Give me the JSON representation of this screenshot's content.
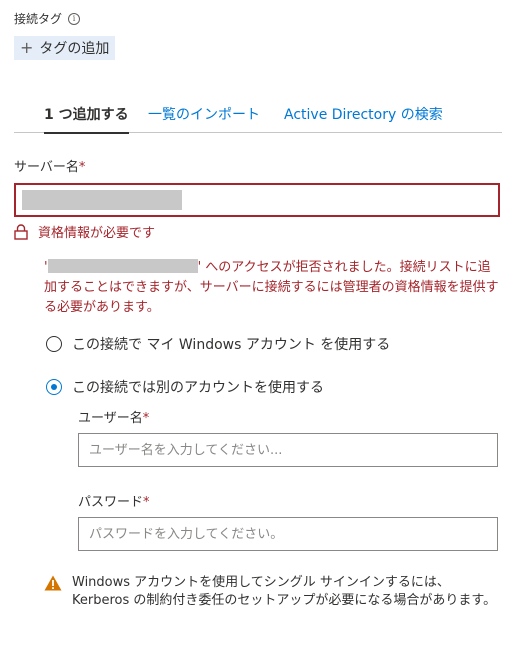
{
  "tags": {
    "label": "接続タグ",
    "info_icon": "info-icon",
    "add_button": "タグの追加",
    "add_icon": "plus-icon"
  },
  "tabs": [
    {
      "label": "1 つ追加する",
      "active": true
    },
    {
      "label": "一覧のインポート",
      "active": false
    },
    {
      "label": "Active Directory の検索",
      "active": false
    }
  ],
  "server": {
    "label": "サーバー名",
    "required_mark": "*",
    "value_redacted": true
  },
  "credential_error": {
    "icon": "lock-icon",
    "text": "資格情報が必要です",
    "message_prefix": "'",
    "message_suffix": "' へのアクセスが拒否されました。接続リストに追加することはできますが、サーバーに接続するには管理者の資格情報を提供する必要があります。"
  },
  "account_options": [
    {
      "label": "この接続で マイ Windows アカウント を使用する",
      "selected": false
    },
    {
      "label": "この接続では別のアカウントを使用する",
      "selected": true
    }
  ],
  "username": {
    "label": "ユーザー名",
    "required_mark": "*",
    "placeholder": "ユーザー名を入力してください..."
  },
  "password": {
    "label": "パスワード",
    "required_mark": "*",
    "placeholder": "パスワードを入力してください。"
  },
  "warning": {
    "icon": "warning-icon",
    "text": "Windows アカウントを使用してシングル サインインするには、Kerberos の制約付き委任のセットアップが必要になる場合があります。"
  },
  "colors": {
    "error": "#a4262c",
    "accent": "#0078d4",
    "tag_bg": "#e5eef8",
    "warning": "#d47500"
  }
}
